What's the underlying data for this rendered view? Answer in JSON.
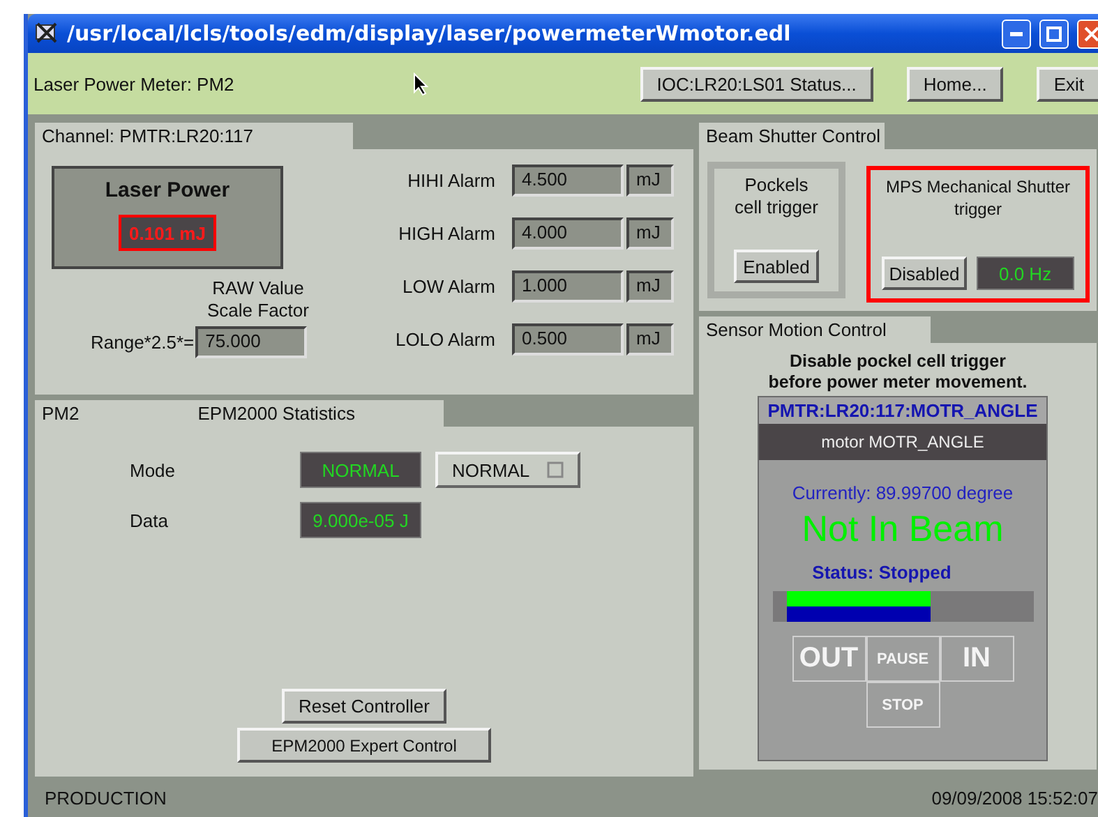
{
  "window": {
    "title": "/usr/local/lcls/tools/edm/display/laser/powermeterWmotor.edl"
  },
  "header": {
    "title": "Laser Power Meter: PM2",
    "buttons": [
      "IOC:LR20:LS01 Status...",
      "Home...",
      "Exit"
    ]
  },
  "channel_panel": {
    "tab": "Channel: PMTR:LR20:117",
    "laser_power": {
      "title": "Laser Power",
      "reading": "0.101 mJ",
      "alarm": true
    },
    "alarms": [
      {
        "label": "HIHI Alarm",
        "value": "4.500",
        "unit": "mJ"
      },
      {
        "label": "HIGH Alarm",
        "value": "4.000",
        "unit": "mJ"
      },
      {
        "label": "LOW Alarm",
        "value": "1.000",
        "unit": "mJ"
      },
      {
        "label": "LOLO Alarm",
        "value": "0.500",
        "unit": "mJ"
      }
    ],
    "scale_caption": "RAW Value\nScale Factor",
    "range_label": "Range*2.5*=",
    "range_value": "75.000"
  },
  "stats_panel": {
    "tab_left": "PM2",
    "tab_title": "EPM2000 Statistics",
    "rows": [
      {
        "label": "Mode",
        "reading": "NORMAL",
        "kind": "menu",
        "menu": "NORMAL"
      },
      {
        "label": "Data",
        "reading": "9.000e-05  J",
        "kind": "plain"
      }
    ],
    "buttons": [
      "Reset Controller",
      "EPM2000 Expert Control"
    ]
  },
  "shutter_panel": {
    "tab": "Beam Shutter Control",
    "pockels": {
      "title": "Pockels\ncell trigger",
      "button": "Enabled",
      "alarm": false
    },
    "mps": {
      "title": "MPS Mechanical Shutter\ntrigger",
      "button": "Disabled",
      "reading": "0.0 Hz",
      "alarm": true
    }
  },
  "motion_panel": {
    "tab": "Sensor Motion Control",
    "warning": "Disable pockel cell trigger\nbefore power meter movement.",
    "motor": {
      "pv": "PMTR:LR20:117:MOTR_ANGLE",
      "name": "motor MOTR_ANGLE",
      "current": "Currently: 89.99700 degree",
      "position": "Not In Beam",
      "status": "Status: Stopped",
      "buttons": [
        {
          "label": "OUT",
          "disabled": true
        },
        {
          "label": "PAUSE",
          "disabled": true
        },
        {
          "label": "IN",
          "disabled": true
        },
        {
          "label": "STOP",
          "disabled": true
        }
      ]
    }
  },
  "status_bar": {
    "mode": "PRODUCTION",
    "timestamp": "09/09/2008 15:52:07"
  }
}
